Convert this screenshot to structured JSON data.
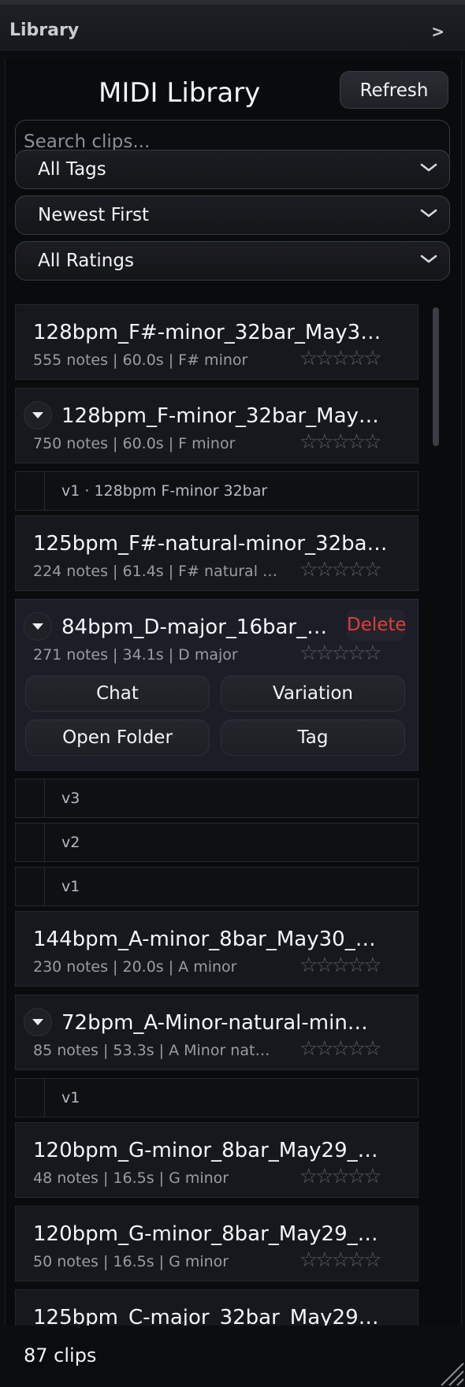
{
  "topbar": {
    "title": "Library",
    "arrow": ">"
  },
  "header": {
    "title": "MIDI Library",
    "refresh_label": "Refresh"
  },
  "search": {
    "placeholder": "Search clips...",
    "value": ""
  },
  "filters": {
    "tags": "All Tags",
    "sort": "Newest First",
    "ratings": "All Ratings"
  },
  "star_glyphs": "☆☆☆☆☆",
  "clips": [
    {
      "title": "128bpm_F#-minor_32bar_May3…",
      "meta": "555 notes | 60.0s | F# minor"
    },
    {
      "title": "128bpm_F-minor_32bar_May…",
      "meta": "750 notes | 60.0s | F minor"
    },
    {
      "title": "125bpm_F#-natural-minor_32ba…",
      "meta": "224 notes | 61.4s | F# natural …"
    },
    {
      "title": "84bpm_D-major_16bar_…",
      "meta": "271 notes | 34.1s | D major"
    },
    {
      "title": "144bpm_A-minor_8bar_May30_…",
      "meta": "230 notes | 20.0s | A minor"
    },
    {
      "title": "72bpm_A-Minor-natural-min…",
      "meta": "85 notes | 53.3s | A Minor nat…"
    },
    {
      "title": "120bpm_G-minor_8bar_May29_…",
      "meta": "48 notes | 16.5s | G minor"
    },
    {
      "title": "120bpm_G-minor_8bar_May29_…",
      "meta": "50 notes | 16.5s | G minor"
    },
    {
      "title": "125bpm_C-major_32bar_May29…",
      "meta": ""
    }
  ],
  "versions": {
    "clip2_v1": "v1  ·  128bpm F-minor 32bar",
    "clip4_v3": "v3",
    "clip4_v2": "v2",
    "clip4_v1": "v1",
    "clip6_v1": "v1"
  },
  "actions": {
    "delete": "Delete",
    "chat": "Chat",
    "variation": "Variation",
    "open_folder": "Open Folder",
    "tag": "Tag"
  },
  "footer": {
    "count": "87 clips"
  },
  "colors": {
    "accent_delete": "#d9403f",
    "background": "#0a0b0d",
    "card": "#17181d"
  }
}
